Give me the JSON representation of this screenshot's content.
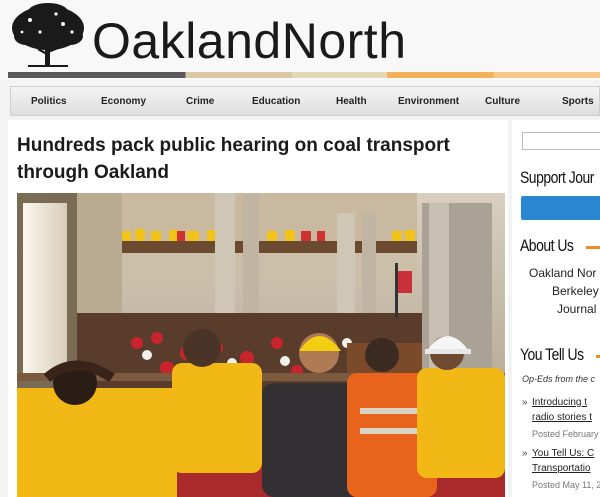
{
  "header": {
    "site_title": "OaklandNorth",
    "logo_icon": "oak-tree-icon"
  },
  "nav": {
    "items": [
      "Politics",
      "Economy",
      "Crime",
      "Education",
      "Health",
      "Environment",
      "Culture",
      "Sports"
    ]
  },
  "article": {
    "headline": "Hundreds pack public hearing on coal transport through Oakland"
  },
  "sidebar": {
    "support_heading": "Support Jour",
    "about_heading": "About Us",
    "about_lines": [
      "Oakland Nor",
      "Berkeley",
      "Journal"
    ],
    "you_tell_us_heading": "You Tell Us",
    "opeds_text": "Op-Eds from the c",
    "posts": [
      {
        "lines": [
          "Introducing t",
          "radio stories t"
        ],
        "date": "Posted February"
      },
      {
        "lines": [
          "You Tell Us: C",
          "Transportatio"
        ],
        "date": "Posted May 11, 2"
      }
    ]
  },
  "colors": {
    "accent_orange": "#f08a24",
    "support_blue": "#2a86d0",
    "crowd_yellow": "#f2c418"
  }
}
